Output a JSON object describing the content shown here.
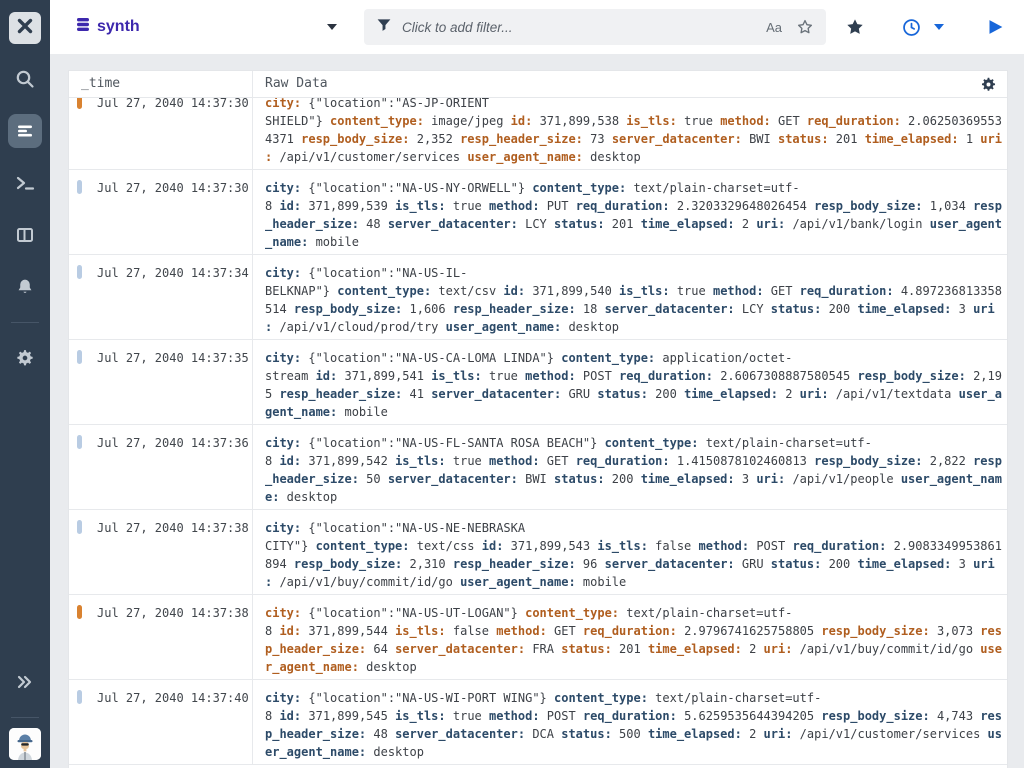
{
  "colors": {
    "sidebar_bg": "#2f3e4f",
    "accent_purple": "#3d28ad",
    "accent_blue": "#1766d9",
    "key_navy": "#2c4a68",
    "key_orange": "#b05e1f",
    "marker_blue": "#b9cce3",
    "marker_orange": "#d98230"
  },
  "sidebar": {
    "icons": [
      "x-logo-icon",
      "search-icon",
      "logs-icon",
      "terminal-icon",
      "columns-icon",
      "bell-icon",
      "gear-icon",
      "collapse-chevrons-icon",
      "avatar"
    ]
  },
  "topbar": {
    "dataset": "synth",
    "filter_placeholder": "Click to add filter...",
    "case_sensitivity_label": "Aa"
  },
  "table": {
    "columns": [
      "_time",
      "Raw Data"
    ],
    "rows": [
      {
        "time": "Jul 27, 2040 14:37:30",
        "variant": "v-orange",
        "lines": [
          [
            [
              "city:",
              1
            ],
            [
              " {\"location\":\"AS-JP-ORIENT",
              0
            ]
          ],
          [
            [
              "SHIELD\"} ",
              0
            ],
            [
              "content_type:",
              1
            ],
            [
              " image/jpeg ",
              0
            ],
            [
              "id:",
              1
            ],
            [
              " 371,899,538 ",
              0
            ],
            [
              "is_tls:",
              1
            ],
            [
              " true ",
              0
            ],
            [
              "method:",
              1
            ],
            [
              " GET ",
              0
            ],
            [
              "req_duration:",
              1
            ],
            [
              " 2.06250369553",
              0
            ]
          ],
          [
            [
              "4371 ",
              0
            ],
            [
              "resp_body_size:",
              1
            ],
            [
              " 2,352 ",
              0
            ],
            [
              "resp_header_size:",
              1
            ],
            [
              " 73 ",
              0
            ],
            [
              "server_datacenter:",
              1
            ],
            [
              " BWI ",
              0
            ],
            [
              "status:",
              1
            ],
            [
              " 201 ",
              0
            ],
            [
              "time_elapsed:",
              1
            ],
            [
              " 1 ",
              0
            ],
            [
              "uri",
              1
            ]
          ],
          [
            [
              ":",
              1
            ],
            [
              " /api/v1/customer/services ",
              0
            ],
            [
              "user_agent_name:",
              1
            ],
            [
              " desktop",
              0
            ]
          ]
        ]
      },
      {
        "time": "Jul 27, 2040 14:37:30",
        "variant": "v-blue",
        "lines": [
          [
            [
              "city:",
              1
            ],
            [
              " {\"location\":\"NA-US-NY-ORWELL\"} ",
              0
            ],
            [
              "content_type:",
              1
            ],
            [
              " text/plain-charset=utf-",
              0
            ]
          ],
          [
            [
              "8 ",
              0
            ],
            [
              "id:",
              1
            ],
            [
              " 371,899,539 ",
              0
            ],
            [
              "is_tls:",
              1
            ],
            [
              " true ",
              0
            ],
            [
              "method:",
              1
            ],
            [
              " PUT ",
              0
            ],
            [
              "req_duration:",
              1
            ],
            [
              " 2.3203329648026454 ",
              0
            ],
            [
              "resp_body_size:",
              1
            ],
            [
              " 1,034 ",
              0
            ],
            [
              "resp",
              1
            ]
          ],
          [
            [
              "_header_size:",
              1
            ],
            [
              " 48 ",
              0
            ],
            [
              "server_datacenter:",
              1
            ],
            [
              " LCY ",
              0
            ],
            [
              "status:",
              1
            ],
            [
              " 201 ",
              0
            ],
            [
              "time_elapsed:",
              1
            ],
            [
              " 2 ",
              0
            ],
            [
              "uri:",
              1
            ],
            [
              " /api/v1/bank/login ",
              0
            ],
            [
              "user_agent",
              1
            ]
          ],
          [
            [
              "_name:",
              1
            ],
            [
              " mobile",
              0
            ]
          ]
        ]
      },
      {
        "time": "Jul 27, 2040 14:37:34",
        "variant": "v-blue",
        "lines": [
          [
            [
              "city:",
              1
            ],
            [
              " {\"location\":\"NA-US-IL-",
              0
            ]
          ],
          [
            [
              "BELKNAP\"} ",
              0
            ],
            [
              "content_type:",
              1
            ],
            [
              " text/csv ",
              0
            ],
            [
              "id:",
              1
            ],
            [
              " 371,899,540 ",
              0
            ],
            [
              "is_tls:",
              1
            ],
            [
              " true ",
              0
            ],
            [
              "method:",
              1
            ],
            [
              " GET ",
              0
            ],
            [
              "req_duration:",
              1
            ],
            [
              " 4.897236813358",
              0
            ]
          ],
          [
            [
              "514 ",
              0
            ],
            [
              "resp_body_size:",
              1
            ],
            [
              " 1,606 ",
              0
            ],
            [
              "resp_header_size:",
              1
            ],
            [
              " 18 ",
              0
            ],
            [
              "server_datacenter:",
              1
            ],
            [
              " LCY ",
              0
            ],
            [
              "status:",
              1
            ],
            [
              " 200 ",
              0
            ],
            [
              "time_elapsed:",
              1
            ],
            [
              " 3 ",
              0
            ],
            [
              "uri",
              1
            ]
          ],
          [
            [
              ":",
              1
            ],
            [
              " /api/v1/cloud/prod/try ",
              0
            ],
            [
              "user_agent_name:",
              1
            ],
            [
              " desktop",
              0
            ]
          ]
        ]
      },
      {
        "time": "Jul 27, 2040 14:37:35",
        "variant": "v-blue",
        "lines": [
          [
            [
              "city:",
              1
            ],
            [
              " {\"location\":\"NA-US-CA-LOMA LINDA\"} ",
              0
            ],
            [
              "content_type:",
              1
            ],
            [
              " application/octet-",
              0
            ]
          ],
          [
            [
              "stream ",
              0
            ],
            [
              "id:",
              1
            ],
            [
              " 371,899,541 ",
              0
            ],
            [
              "is_tls:",
              1
            ],
            [
              " true ",
              0
            ],
            [
              "method:",
              1
            ],
            [
              " POST ",
              0
            ],
            [
              "req_duration:",
              1
            ],
            [
              " 2.6067308887580545 ",
              0
            ],
            [
              "resp_body_size:",
              1
            ],
            [
              " 2,19",
              0
            ]
          ],
          [
            [
              "5 ",
              0
            ],
            [
              "resp_header_size:",
              1
            ],
            [
              " 41 ",
              0
            ],
            [
              "server_datacenter:",
              1
            ],
            [
              " GRU ",
              0
            ],
            [
              "status:",
              1
            ],
            [
              " 200 ",
              0
            ],
            [
              "time_elapsed:",
              1
            ],
            [
              " 2 ",
              0
            ],
            [
              "uri:",
              1
            ],
            [
              " /api/v1/textdata ",
              0
            ],
            [
              "user_a",
              1
            ]
          ],
          [
            [
              "gent_name:",
              1
            ],
            [
              " mobile",
              0
            ]
          ]
        ]
      },
      {
        "time": "Jul 27, 2040 14:37:36",
        "variant": "v-blue",
        "lines": [
          [
            [
              "city:",
              1
            ],
            [
              " {\"location\":\"NA-US-FL-SANTA ROSA BEACH\"} ",
              0
            ],
            [
              "content_type:",
              1
            ],
            [
              " text/plain-charset=utf-",
              0
            ]
          ],
          [
            [
              "8 ",
              0
            ],
            [
              "id:",
              1
            ],
            [
              " 371,899,542 ",
              0
            ],
            [
              "is_tls:",
              1
            ],
            [
              " true ",
              0
            ],
            [
              "method:",
              1
            ],
            [
              " GET ",
              0
            ],
            [
              "req_duration:",
              1
            ],
            [
              " 1.4150878102460813 ",
              0
            ],
            [
              "resp_body_size:",
              1
            ],
            [
              " 2,822 ",
              0
            ],
            [
              "resp",
              1
            ]
          ],
          [
            [
              "_header_size:",
              1
            ],
            [
              " 50 ",
              0
            ],
            [
              "server_datacenter:",
              1
            ],
            [
              " BWI ",
              0
            ],
            [
              "status:",
              1
            ],
            [
              " 200 ",
              0
            ],
            [
              "time_elapsed:",
              1
            ],
            [
              " 3 ",
              0
            ],
            [
              "uri:",
              1
            ],
            [
              " /api/v1/people ",
              0
            ],
            [
              "user_agent_nam",
              1
            ]
          ],
          [
            [
              "e:",
              1
            ],
            [
              " desktop",
              0
            ]
          ]
        ]
      },
      {
        "time": "Jul 27, 2040 14:37:38",
        "variant": "v-blue",
        "lines": [
          [
            [
              "city:",
              1
            ],
            [
              " {\"location\":\"NA-US-NE-NEBRASKA",
              0
            ]
          ],
          [
            [
              "CITY\"} ",
              0
            ],
            [
              "content_type:",
              1
            ],
            [
              " text/css ",
              0
            ],
            [
              "id:",
              1
            ],
            [
              " 371,899,543 ",
              0
            ],
            [
              "is_tls:",
              1
            ],
            [
              " false ",
              0
            ],
            [
              "method:",
              1
            ],
            [
              " POST ",
              0
            ],
            [
              "req_duration:",
              1
            ],
            [
              " 2.9083349953861",
              0
            ]
          ],
          [
            [
              "894 ",
              0
            ],
            [
              "resp_body_size:",
              1
            ],
            [
              " 2,310 ",
              0
            ],
            [
              "resp_header_size:",
              1
            ],
            [
              " 96 ",
              0
            ],
            [
              "server_datacenter:",
              1
            ],
            [
              " GRU ",
              0
            ],
            [
              "status:",
              1
            ],
            [
              " 200 ",
              0
            ],
            [
              "time_elapsed:",
              1
            ],
            [
              " 3 ",
              0
            ],
            [
              "uri",
              1
            ]
          ],
          [
            [
              ":",
              1
            ],
            [
              " /api/v1/buy/commit/id/go ",
              0
            ],
            [
              "user_agent_name:",
              1
            ],
            [
              " mobile",
              0
            ]
          ]
        ]
      },
      {
        "time": "Jul 27, 2040 14:37:38",
        "variant": "v-orange",
        "lines": [
          [
            [
              "city:",
              1
            ],
            [
              " {\"location\":\"NA-US-UT-LOGAN\"} ",
              0
            ],
            [
              "content_type:",
              1
            ],
            [
              " text/plain-charset=utf-",
              0
            ]
          ],
          [
            [
              "8 ",
              0
            ],
            [
              "id:",
              1
            ],
            [
              " 371,899,544 ",
              0
            ],
            [
              "is_tls:",
              1
            ],
            [
              " false ",
              0
            ],
            [
              "method:",
              1
            ],
            [
              " GET ",
              0
            ],
            [
              "req_duration:",
              1
            ],
            [
              " 2.9796741625758805 ",
              0
            ],
            [
              "resp_body_size:",
              1
            ],
            [
              " 3,073 ",
              0
            ],
            [
              "res",
              1
            ]
          ],
          [
            [
              "p_header_size:",
              1
            ],
            [
              " 64 ",
              0
            ],
            [
              "server_datacenter:",
              1
            ],
            [
              " FRA ",
              0
            ],
            [
              "status:",
              1
            ],
            [
              " 201 ",
              0
            ],
            [
              "time_elapsed:",
              1
            ],
            [
              " 2 ",
              0
            ],
            [
              "uri:",
              1
            ],
            [
              " /api/v1/buy/commit/id/go ",
              0
            ],
            [
              "use",
              1
            ]
          ],
          [
            [
              "r_agent_name:",
              1
            ],
            [
              " desktop",
              0
            ]
          ]
        ]
      },
      {
        "time": "Jul 27, 2040 14:37:40",
        "variant": "v-blue",
        "lines": [
          [
            [
              "city:",
              1
            ],
            [
              " {\"location\":\"NA-US-WI-PORT WING\"} ",
              0
            ],
            [
              "content_type:",
              1
            ],
            [
              " text/plain-charset=utf-",
              0
            ]
          ],
          [
            [
              "8 ",
              0
            ],
            [
              "id:",
              1
            ],
            [
              " 371,899,545 ",
              0
            ],
            [
              "is_tls:",
              1
            ],
            [
              " true ",
              0
            ],
            [
              "method:",
              1
            ],
            [
              " POST ",
              0
            ],
            [
              "req_duration:",
              1
            ],
            [
              " 5.6259535644394205 ",
              0
            ],
            [
              "resp_body_size:",
              1
            ],
            [
              " 4,743 ",
              0
            ],
            [
              "res",
              1
            ]
          ],
          [
            [
              "p_header_size:",
              1
            ],
            [
              " 48 ",
              0
            ],
            [
              "server_datacenter:",
              1
            ],
            [
              " DCA ",
              0
            ],
            [
              "status:",
              1
            ],
            [
              " 500 ",
              0
            ],
            [
              "time_elapsed:",
              1
            ],
            [
              " 2 ",
              0
            ],
            [
              "uri:",
              1
            ],
            [
              " /api/v1/customer/services ",
              0
            ],
            [
              "us",
              1
            ]
          ],
          [
            [
              "er_agent_name:",
              1
            ],
            [
              " desktop",
              0
            ]
          ]
        ]
      }
    ]
  }
}
